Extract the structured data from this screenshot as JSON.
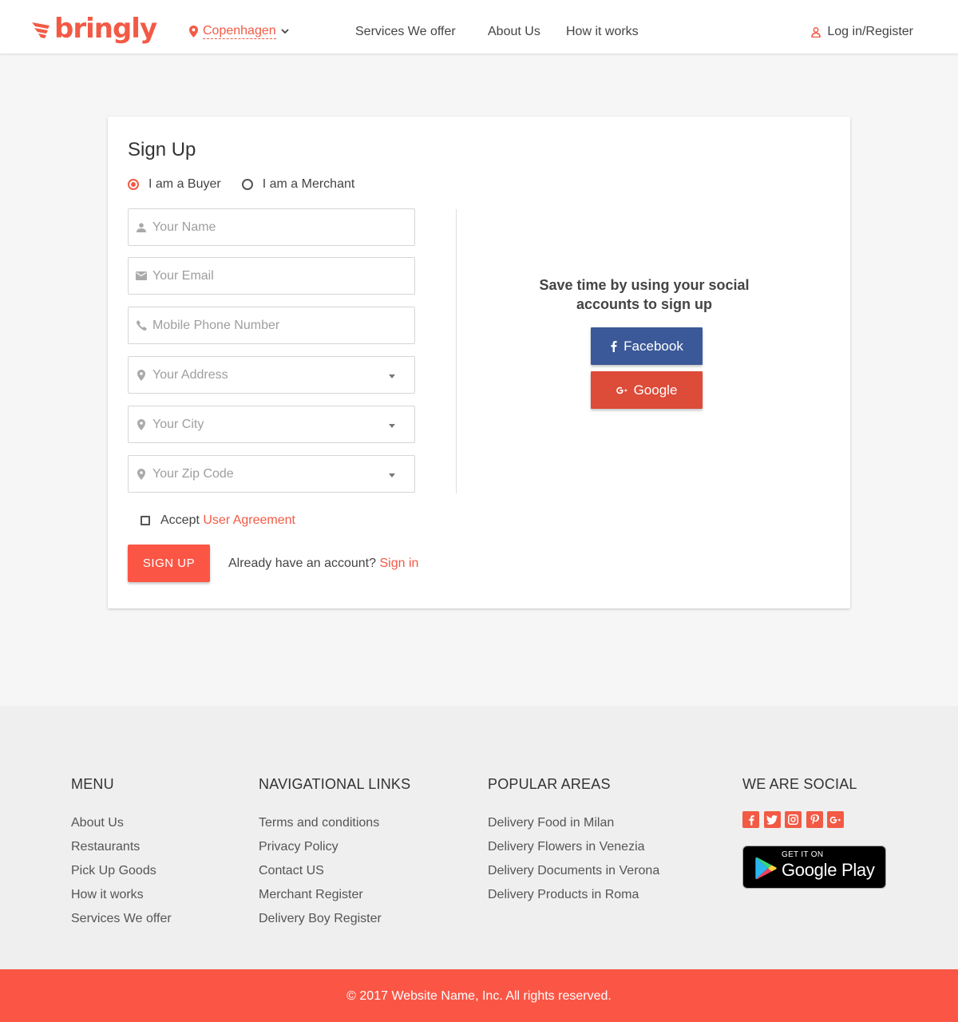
{
  "header": {
    "brand": "bringly",
    "location": "Copenhagen",
    "nav": [
      "Services  We offer",
      "About Us",
      "How it works"
    ],
    "login": "Log in/Register"
  },
  "signup": {
    "title": "Sign Up",
    "roles": [
      {
        "label": "I am a Buyer",
        "selected": true
      },
      {
        "label": "I am a Merchant",
        "selected": false
      }
    ],
    "fields": {
      "name": "Your Name",
      "email": "Your Email",
      "phone": "Mobile Phone Number",
      "address": "Your Address",
      "city": "Your City",
      "zip": "Your Zip Code"
    },
    "accept_prefix": "Accept",
    "accept_link": "User Agreement",
    "submit": "SIGN UP",
    "have_account": "Already have an account?",
    "sign_in": "Sign in",
    "social_text": "Save time by using your social accounts to sign up",
    "facebook": "Facebook",
    "google": "Google"
  },
  "footer": {
    "menu": {
      "title": "MENU",
      "links": [
        "About Us",
        "Restaurants",
        "Pick Up Goods",
        "How it works",
        "Services We offer"
      ]
    },
    "nav": {
      "title": "NAVIGATIONAL LINKS",
      "links": [
        "Terms and conditions",
        "Privacy Policy",
        "Contact US",
        "Merchant Register",
        "Delivery Boy Register"
      ]
    },
    "areas": {
      "title": "POPULAR AREAS",
      "links": [
        "Delivery Food in Milan",
        "Delivery Flowers in Venezia",
        "Delivery Documents in Verona",
        "Delivery Products in Roma"
      ]
    },
    "social": {
      "title": "WE ARE SOCIAL",
      "icons": [
        "facebook-icon",
        "twitter-icon",
        "instagram-icon",
        "pinterest-icon",
        "google-plus-icon"
      ],
      "gplay_small": "GET IT ON",
      "gplay_big": "Google Play"
    },
    "copyright": "© 2017 Website Name, Inc. All rights reserved."
  },
  "colors": {
    "accent": "#fb5645",
    "facebook": "#3b5998",
    "google": "#dd4b39"
  }
}
